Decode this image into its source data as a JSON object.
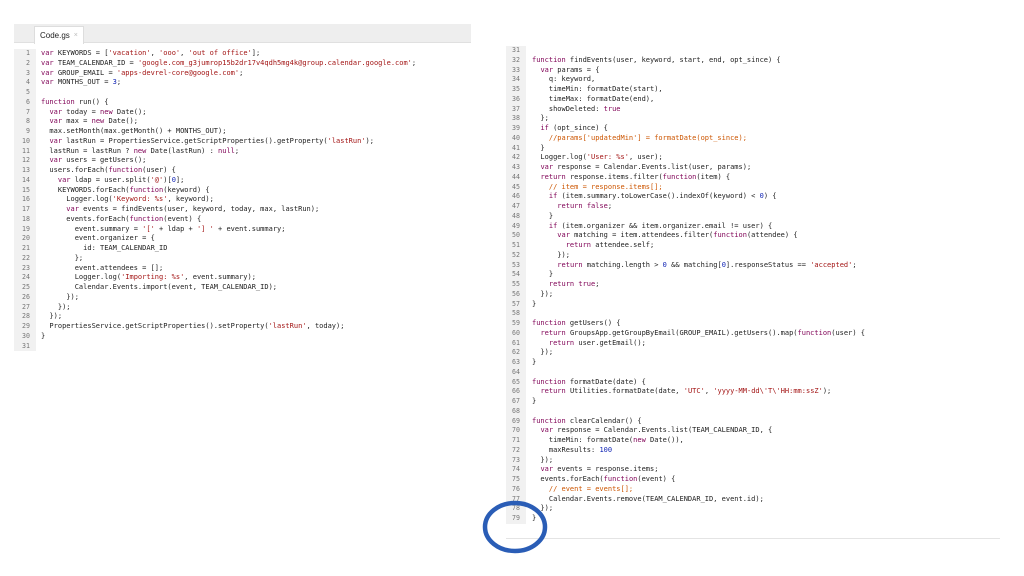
{
  "left_editor": {
    "tab_label": "Code.gs",
    "tab_close": "×",
    "line_numbers": [
      "1",
      "2",
      "3",
      "4",
      "5",
      "6",
      "7",
      "8",
      "9",
      "10",
      "11",
      "12",
      "13",
      "14",
      "15",
      "16",
      "17",
      "18",
      "19",
      "20",
      "21",
      "22",
      "23",
      "24",
      "25",
      "26",
      "27",
      "28",
      "29",
      "30",
      "31"
    ],
    "lines": [
      "var KEYWORDS = ['vacation', 'ooo', 'out of office'];",
      "var TEAM_CALENDAR_ID = 'google.com_g3jumrop15b2dr17v4qdh5mg4k@group.calendar.google.com';",
      "var GROUP_EMAIL = 'apps-devrel-core@google.com';",
      "var MONTHS_OUT = 3;",
      "",
      "function run() {",
      "  var today = new Date();",
      "  var max = new Date();",
      "  max.setMonth(max.getMonth() + MONTHS_OUT);",
      "  var lastRun = PropertiesService.getScriptProperties().getProperty('lastRun');",
      "  lastRun = lastRun ? new Date(lastRun) : null;",
      "  var users = getUsers();",
      "  users.forEach(function(user) {",
      "    var ldap = user.split('@')[0];",
      "    KEYWORDS.forEach(function(keyword) {",
      "      Logger.log('Keyword: %s', keyword);",
      "      var events = findEvents(user, keyword, today, max, lastRun);",
      "      events.forEach(function(event) {",
      "        event.summary = '[' + ldap + '] ' + event.summary;",
      "        event.organizer = {",
      "          id: TEAM_CALENDAR_ID",
      "        };",
      "        event.attendees = [];",
      "        Logger.log('Importing: %s', event.summary);",
      "        Calendar.Events.import(event, TEAM_CALENDAR_ID);",
      "      });",
      "    });",
      "  });",
      "  PropertiesService.getScriptProperties().setProperty('lastRun', today);",
      "}",
      ""
    ]
  },
  "right_editor": {
    "line_numbers": [
      "31",
      "32",
      "33",
      "34",
      "35",
      "36",
      "37",
      "38",
      "39",
      "40",
      "41",
      "42",
      "43",
      "44",
      "45",
      "46",
      "47",
      "48",
      "49",
      "50",
      "51",
      "52",
      "53",
      "54",
      "55",
      "56",
      "57",
      "58",
      "59",
      "60",
      "61",
      "62",
      "63",
      "64",
      "65",
      "66",
      "67",
      "68",
      "69",
      "70",
      "71",
      "72",
      "73",
      "74",
      "75",
      "76",
      "77",
      "78",
      "79"
    ],
    "lines": [
      "",
      "function findEvents(user, keyword, start, end, opt_since) {",
      "  var params = {",
      "    q: keyword,",
      "    timeMin: formatDate(start),",
      "    timeMax: formatDate(end),",
      "    showDeleted: true",
      "  };",
      "  if (opt_since) {",
      "    //params['updatedMin'] = formatDate(opt_since);",
      "  }",
      "  Logger.log('User: %s', user);",
      "  var response = Calendar.Events.list(user, params);",
      "  return response.items.filter(function(item) {",
      "    // item = response.items[];",
      "    if (item.summary.toLowerCase().indexOf(keyword) < 0) {",
      "      return false;",
      "    }",
      "    if (item.organizer && item.organizer.email != user) {",
      "      var matching = item.attendees.filter(function(attendee) {",
      "        return attendee.self;",
      "      });",
      "      return matching.length > 0 && matching[0].responseStatus == 'accepted';",
      "    }",
      "    return true;",
      "  });",
      "}",
      "",
      "function getUsers() {",
      "  return GroupsApp.getGroupByEmail(GROUP_EMAIL).getUsers().map(function(user) {",
      "    return user.getEmail();",
      "  });",
      "}",
      "",
      "function formatDate(date) {",
      "  return Utilities.formatDate(date, 'UTC', 'yyyy-MM-dd\\'T\\'HH:mm:ssZ');",
      "}",
      "",
      "function clearCalendar() {",
      "  var response = Calendar.Events.list(TEAM_CALENDAR_ID, {",
      "    timeMin: formatDate(new Date()),",
      "    maxResults: 100",
      "  });",
      "  var events = response.items;",
      "  events.forEach(function(event) {",
      "    // event = events[];",
      "    Calendar.Events.remove(TEAM_CALENDAR_ID, event.id);",
      "  });",
      "}"
    ]
  },
  "colors": {
    "annotation_circle": "#2a5db6",
    "keyword": "#7f0055",
    "string": "#a31515",
    "variable": "#0b1fb3",
    "comment": "#cc5500",
    "gutter": "#f1f1f1",
    "tabbar": "#eeeeee"
  }
}
